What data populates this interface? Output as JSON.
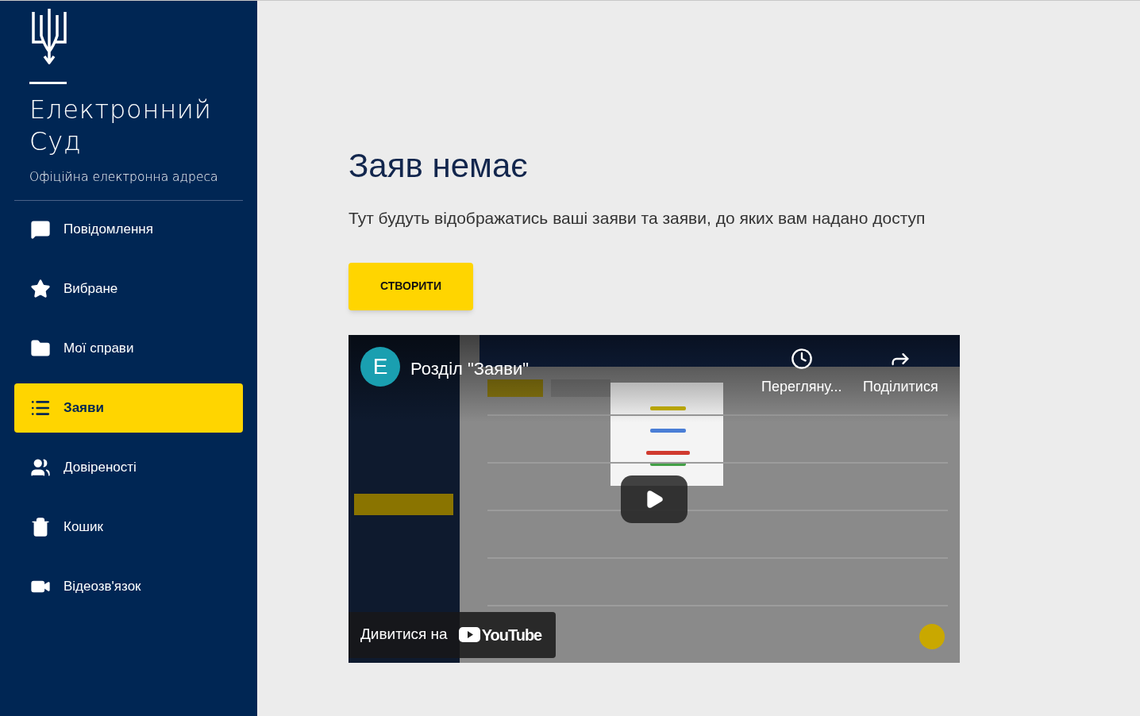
{
  "brand": {
    "title_line1": "Електронний",
    "title_line2": "Суд",
    "subtitle": "Офіційна електронна адреса"
  },
  "nav": [
    {
      "label": "Повідомлення",
      "kind": "messages",
      "selected": false
    },
    {
      "label": "Вибране",
      "kind": "favorites",
      "selected": false
    },
    {
      "label": "Мої справи",
      "kind": "cases",
      "selected": false
    },
    {
      "label": "Заяви",
      "kind": "applications",
      "selected": true
    },
    {
      "label": "Довіреності",
      "kind": "powers",
      "selected": false
    },
    {
      "label": "Кошик",
      "kind": "trash",
      "selected": false
    },
    {
      "label": "Відеозв'язок",
      "kind": "video",
      "selected": false
    }
  ],
  "empty_state": {
    "heading": "Заяв немає",
    "description": "Тут будуть відображатись ваші заяви та заяви, до яких вам надано доступ",
    "button": "СТВОРИТИ"
  },
  "video": {
    "channel_initial": "E",
    "title": "Розділ \"Заяви\"",
    "watch_later": "Перегляну...",
    "share": "Поділитися",
    "watch_on": "Дивитися на",
    "platform": "YouTube"
  }
}
